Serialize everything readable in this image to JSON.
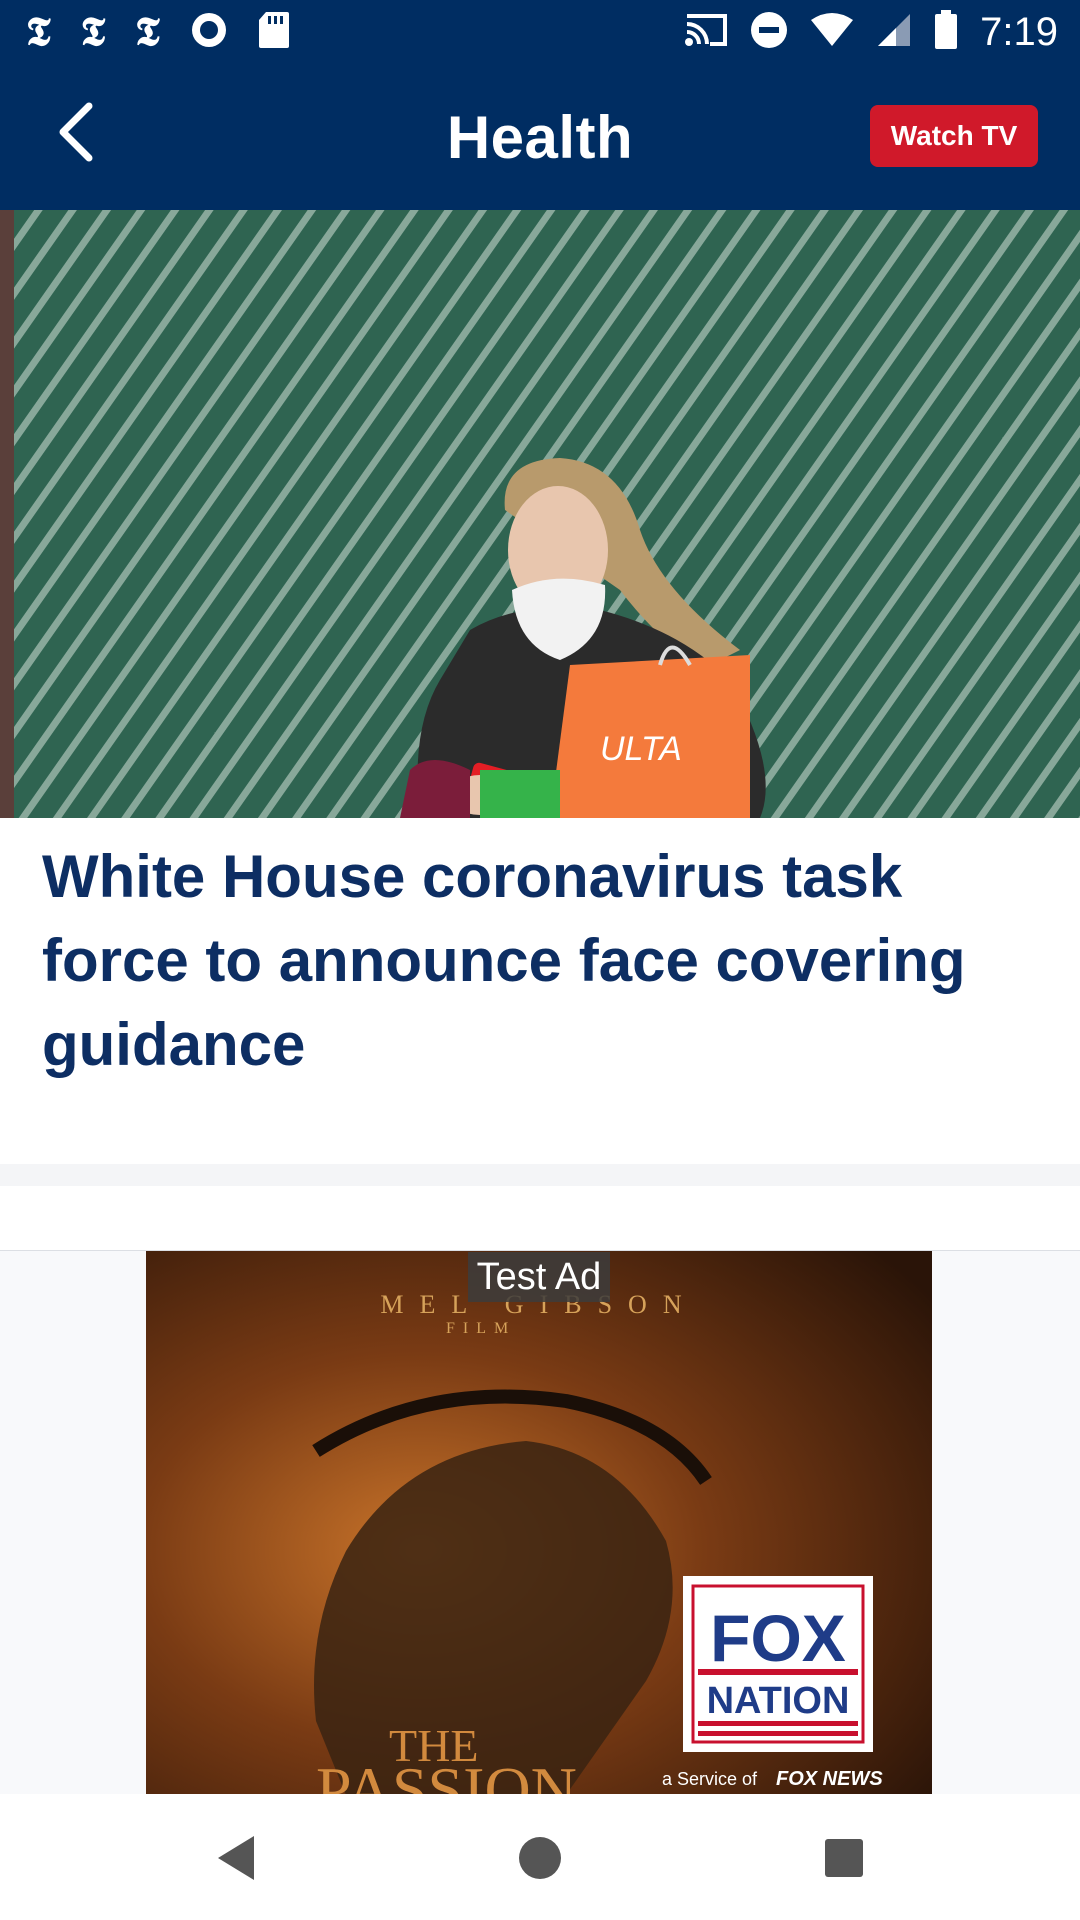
{
  "status_bar": {
    "notification_icons": [
      "nyt-icon",
      "nyt-icon",
      "nyt-icon",
      "radio-icon",
      "sd-card-icon"
    ],
    "nyt_glyph": "𝕿",
    "time": "7:19",
    "system_icons": [
      "cast-icon",
      "do-not-disturb-icon",
      "wifi-icon",
      "cellular-signal-icon",
      "battery-icon"
    ]
  },
  "app_bar": {
    "title": "Health",
    "watch_tv_label": "Watch TV"
  },
  "article": {
    "headline": "White House coronavirus task force to announce face covering guidance"
  },
  "ad": {
    "label": "Test Ad",
    "kicker": "MEL GIBSON",
    "kicker_sub": "FILM",
    "film_title_line1": "THE",
    "film_title_line2": "PASSION",
    "badge_line1": "FOX",
    "badge_line2": "NATION",
    "service_text": "a Service of",
    "service_brand": "FOX NEWS"
  },
  "colors": {
    "brand_navy": "#002d62",
    "headline_navy": "#0d2e63",
    "watch_tv_red": "#d0192a"
  }
}
